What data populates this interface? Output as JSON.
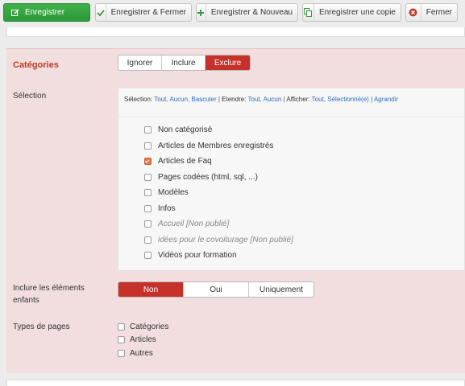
{
  "toolbar": {
    "save_label": "Enregistrer",
    "save_close_label": "Enregistrer & Fermer",
    "save_new_label": "Enregistrer & Nouveau",
    "save_copy_label": "Enregistrer une copie",
    "close_label": "Fermer"
  },
  "categories": {
    "title": "Catégories",
    "mode_options": [
      "Ignorer",
      "Inclure",
      "Exclure"
    ],
    "mode_selected": "Exclure"
  },
  "selection": {
    "label": "Sélection",
    "toolbar": {
      "selection_prefix": "Sélection:",
      "all": "Tout,",
      "none": "Aucun,",
      "toggle": "Basculer",
      "expand_prefix": "Etendre:",
      "expand_all": "Tout,",
      "expand_none": "Aucun",
      "show_prefix": "Afficher:",
      "show_all": "Tout,",
      "show_selected": "Sélectionné(e)",
      "enlarge": "Agrandir"
    },
    "items": [
      {
        "label": "Non catégorisé",
        "checked": false,
        "unpublished": false
      },
      {
        "label": "Articles de Membres enregistrés",
        "checked": false,
        "unpublished": false
      },
      {
        "label": "Articles de Faq",
        "checked": true,
        "unpublished": false
      },
      {
        "label": "Pages codées (html, sql, ...)",
        "checked": false,
        "unpublished": false
      },
      {
        "label": "Modèles",
        "checked": false,
        "unpublished": false
      },
      {
        "label": "Infos",
        "checked": false,
        "unpublished": false
      },
      {
        "label": "Accueil [Non publié]",
        "checked": false,
        "unpublished": true
      },
      {
        "label": "idées pour le covoiturage [Non publié]",
        "checked": false,
        "unpublished": true
      },
      {
        "label": "Vidéos pour formation",
        "checked": false,
        "unpublished": false
      }
    ]
  },
  "include_children": {
    "label_line1": "Inclure les éléments",
    "label_line2": "enfants",
    "options": [
      "Non",
      "Oui",
      "Uniquement"
    ],
    "selected": "Non"
  },
  "page_types": {
    "label": "Types de pages",
    "items": [
      {
        "label": "Catégories",
        "checked": false
      },
      {
        "label": "Articles",
        "checked": false
      },
      {
        "label": "Autres",
        "checked": false
      }
    ]
  },
  "colors": {
    "accent_red": "#c6322a",
    "primary_green": "#2d9a38",
    "panel_pink": "#f2dede",
    "link_blue": "#2a6ebb"
  }
}
